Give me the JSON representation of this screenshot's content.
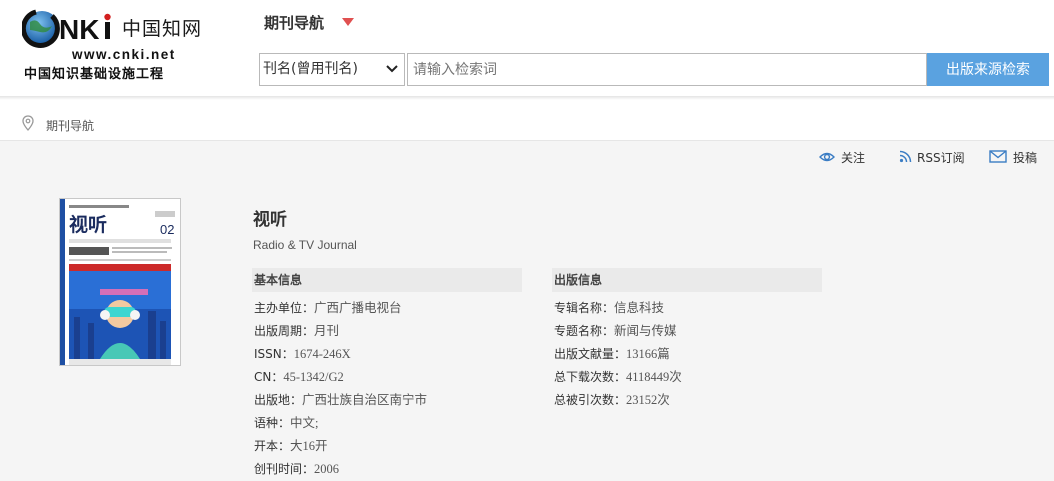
{
  "logo": {
    "brand": "CNKi",
    "cn_name": "中国知网",
    "url": "www.cnki.net",
    "subtitle": "中国知识基础设施工程"
  },
  "header": {
    "nav_title": "期刊导航",
    "search_field_select": "刊名(曾用刊名)",
    "search_placeholder": "请输入检索词",
    "search_button": "出版来源检索"
  },
  "breadcrumb": {
    "label": "期刊导航"
  },
  "actions": {
    "follow": "关注",
    "rss": "RSS订阅",
    "submit": "投稿"
  },
  "journal": {
    "title": "视听",
    "english_title": "Radio & TV Journal",
    "cover": {
      "title": "视听",
      "issue": "02"
    }
  },
  "basic_info": {
    "heading": "基本信息",
    "rows": [
      {
        "label": "主办单位：",
        "value": "广西广播电视台"
      },
      {
        "label": "出版周期：",
        "value": "月刊"
      },
      {
        "label": "ISSN：",
        "value": "1674-246X"
      },
      {
        "label": "CN：",
        "value": "45-1342/G2"
      },
      {
        "label": "出版地：",
        "value": "广西壮族自治区南宁市"
      },
      {
        "label": "语种：",
        "value": "中文;"
      },
      {
        "label": "开本：",
        "value": "大16开"
      },
      {
        "label": "创刊时间：",
        "value": "2006"
      }
    ]
  },
  "publish_info": {
    "heading": "出版信息",
    "rows": [
      {
        "label": "专辑名称：",
        "value": "信息科技"
      },
      {
        "label": "专题名称：",
        "value": "新闻与传媒"
      },
      {
        "label": "出版文献量：",
        "value": "13166篇"
      },
      {
        "label": "总下载次数：",
        "value": "4118449次"
      },
      {
        "label": "总被引次数：",
        "value": "23152次"
      }
    ]
  },
  "colors": {
    "search_button": "#5aa2e0",
    "caret": "#e05050",
    "panel_bg": "#f5f5f5"
  }
}
